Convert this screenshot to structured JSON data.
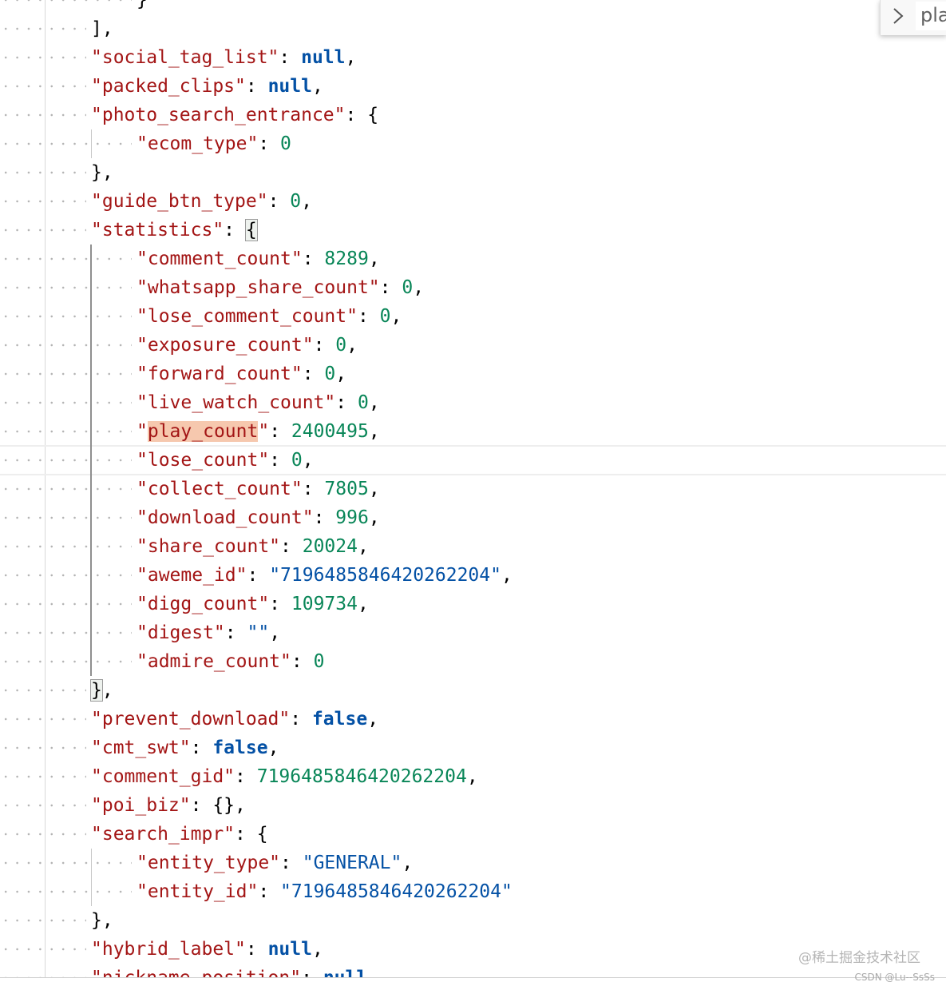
{
  "find": {
    "query": "pla"
  },
  "lines": [
    {
      "code": [
        {
          "t": "}",
          "c": "p"
        }
      ]
    },
    {
      "code": [
        {
          "t": "],",
          "c": "p"
        }
      ]
    },
    {
      "code": [
        {
          "t": "\"social_tag_list\"",
          "c": "k"
        },
        {
          "t": ": ",
          "c": "p"
        },
        {
          "t": "null",
          "c": "kw"
        },
        {
          "t": ",",
          "c": "p"
        }
      ]
    },
    {
      "code": [
        {
          "t": "\"packed_clips\"",
          "c": "k"
        },
        {
          "t": ": ",
          "c": "p"
        },
        {
          "t": "null",
          "c": "kw"
        },
        {
          "t": ",",
          "c": "p"
        }
      ]
    },
    {
      "code": [
        {
          "t": "\"photo_search_entrance\"",
          "c": "k"
        },
        {
          "t": ": {",
          "c": "p"
        }
      ]
    },
    {
      "code": [
        {
          "t": "\"ecom_type\"",
          "c": "k"
        },
        {
          "t": ": ",
          "c": "p"
        },
        {
          "t": "0",
          "c": "n"
        }
      ]
    },
    {
      "code": [
        {
          "t": "},",
          "c": "p"
        }
      ]
    },
    {
      "code": [
        {
          "t": "\"guide_btn_type\"",
          "c": "k"
        },
        {
          "t": ": ",
          "c": "p"
        },
        {
          "t": "0",
          "c": "n"
        },
        {
          "t": ",",
          "c": "p"
        }
      ]
    },
    {
      "code": [
        {
          "t": "\"statistics\"",
          "c": "k"
        },
        {
          "t": ": ",
          "c": "p"
        },
        {
          "t": "{",
          "c": "p",
          "box": true
        }
      ]
    },
    {
      "code": [
        {
          "t": "\"comment_count\"",
          "c": "k"
        },
        {
          "t": ": ",
          "c": "p"
        },
        {
          "t": "8289",
          "c": "n"
        },
        {
          "t": ",",
          "c": "p"
        }
      ]
    },
    {
      "code": [
        {
          "t": "\"whatsapp_share_count\"",
          "c": "k"
        },
        {
          "t": ": ",
          "c": "p"
        },
        {
          "t": "0",
          "c": "n"
        },
        {
          "t": ",",
          "c": "p"
        }
      ]
    },
    {
      "code": [
        {
          "t": "\"lose_comment_count\"",
          "c": "k"
        },
        {
          "t": ": ",
          "c": "p"
        },
        {
          "t": "0",
          "c": "n"
        },
        {
          "t": ",",
          "c": "p"
        }
      ]
    },
    {
      "code": [
        {
          "t": "\"exposure_count\"",
          "c": "k"
        },
        {
          "t": ": ",
          "c": "p"
        },
        {
          "t": "0",
          "c": "n"
        },
        {
          "t": ",",
          "c": "p"
        }
      ]
    },
    {
      "code": [
        {
          "t": "\"forward_count\"",
          "c": "k"
        },
        {
          "t": ": ",
          "c": "p"
        },
        {
          "t": "0",
          "c": "n"
        },
        {
          "t": ",",
          "c": "p"
        }
      ]
    },
    {
      "code": [
        {
          "t": "\"live_watch_count\"",
          "c": "k"
        },
        {
          "t": ": ",
          "c": "p"
        },
        {
          "t": "0",
          "c": "n"
        },
        {
          "t": ",",
          "c": "p"
        }
      ]
    },
    {
      "code": [
        {
          "t": "\"",
          "c": "k"
        },
        {
          "t": "play_count",
          "c": "k",
          "hl": true
        },
        {
          "t": "\"",
          "c": "k"
        },
        {
          "t": ": ",
          "c": "p"
        },
        {
          "t": "2400495",
          "c": "n"
        },
        {
          "t": ",",
          "c": "p"
        }
      ]
    },
    {
      "code": [
        {
          "t": "\"lose_count\"",
          "c": "k"
        },
        {
          "t": ": ",
          "c": "p"
        },
        {
          "t": "0",
          "c": "n"
        },
        {
          "t": ",",
          "c": "p"
        }
      ]
    },
    {
      "code": [
        {
          "t": "\"collect_count\"",
          "c": "k"
        },
        {
          "t": ": ",
          "c": "p"
        },
        {
          "t": "7805",
          "c": "n"
        },
        {
          "t": ",",
          "c": "p"
        }
      ]
    },
    {
      "code": [
        {
          "t": "\"download_count\"",
          "c": "k"
        },
        {
          "t": ": ",
          "c": "p"
        },
        {
          "t": "996",
          "c": "n"
        },
        {
          "t": ",",
          "c": "p"
        }
      ]
    },
    {
      "code": [
        {
          "t": "\"share_count\"",
          "c": "k"
        },
        {
          "t": ": ",
          "c": "p"
        },
        {
          "t": "20024",
          "c": "n"
        },
        {
          "t": ",",
          "c": "p"
        }
      ]
    },
    {
      "code": [
        {
          "t": "\"aweme_id\"",
          "c": "k"
        },
        {
          "t": ": ",
          "c": "p"
        },
        {
          "t": "\"7196485846420262204\"",
          "c": "s"
        },
        {
          "t": ",",
          "c": "p"
        }
      ]
    },
    {
      "code": [
        {
          "t": "\"digg_count\"",
          "c": "k"
        },
        {
          "t": ": ",
          "c": "p"
        },
        {
          "t": "109734",
          "c": "n"
        },
        {
          "t": ",",
          "c": "p"
        }
      ]
    },
    {
      "code": [
        {
          "t": "\"digest\"",
          "c": "k"
        },
        {
          "t": ": ",
          "c": "p"
        },
        {
          "t": "\"\"",
          "c": "s"
        },
        {
          "t": ",",
          "c": "p"
        }
      ]
    },
    {
      "code": [
        {
          "t": "\"admire_count\"",
          "c": "k"
        },
        {
          "t": ": ",
          "c": "p"
        },
        {
          "t": "0",
          "c": "n"
        }
      ]
    },
    {
      "code": [
        {
          "t": "}",
          "c": "p",
          "box": true
        },
        {
          "t": ",",
          "c": "p"
        }
      ]
    },
    {
      "code": [
        {
          "t": "\"prevent_download\"",
          "c": "k"
        },
        {
          "t": ": ",
          "c": "p"
        },
        {
          "t": "false",
          "c": "kw"
        },
        {
          "t": ",",
          "c": "p"
        }
      ]
    },
    {
      "code": [
        {
          "t": "\"cmt_swt\"",
          "c": "k"
        },
        {
          "t": ": ",
          "c": "p"
        },
        {
          "t": "false",
          "c": "kw"
        },
        {
          "t": ",",
          "c": "p"
        }
      ]
    },
    {
      "code": [
        {
          "t": "\"comment_gid\"",
          "c": "k"
        },
        {
          "t": ": ",
          "c": "p"
        },
        {
          "t": "7196485846420262204",
          "c": "n"
        },
        {
          "t": ",",
          "c": "p"
        }
      ]
    },
    {
      "code": [
        {
          "t": "\"poi_biz\"",
          "c": "k"
        },
        {
          "t": ": ",
          "c": "p"
        },
        {
          "t": "{},",
          "c": "p"
        }
      ]
    },
    {
      "code": [
        {
          "t": "\"search_impr\"",
          "c": "k"
        },
        {
          "t": ": {",
          "c": "p"
        }
      ]
    },
    {
      "code": [
        {
          "t": "\"entity_type\"",
          "c": "k"
        },
        {
          "t": ": ",
          "c": "p"
        },
        {
          "t": "\"GENERAL\"",
          "c": "s"
        },
        {
          "t": ",",
          "c": "p"
        }
      ]
    },
    {
      "code": [
        {
          "t": "\"entity_id\"",
          "c": "k"
        },
        {
          "t": ": ",
          "c": "p"
        },
        {
          "t": "\"7196485846420262204\"",
          "c": "s"
        }
      ]
    },
    {
      "code": [
        {
          "t": "},",
          "c": "p"
        }
      ]
    },
    {
      "code": [
        {
          "t": "\"hybrid_label\"",
          "c": "k"
        },
        {
          "t": ": ",
          "c": "p"
        },
        {
          "t": "null",
          "c": "kw"
        },
        {
          "t": ",",
          "c": "p"
        }
      ]
    },
    {
      "code": [
        {
          "t": "\"nickname_position\"",
          "c": "k"
        },
        {
          "t": ": ",
          "c": "p"
        },
        {
          "t": "null",
          "c": "kw"
        }
      ]
    }
  ],
  "watermark": {
    "primary": "@稀土掘金技术社区",
    "secondary": "CSDN @Lu--SsSs"
  }
}
